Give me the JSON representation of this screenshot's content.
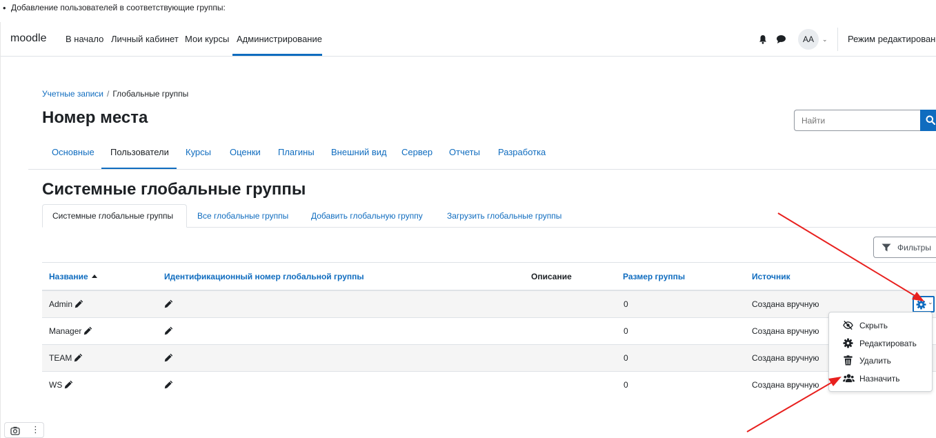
{
  "doc": {
    "bullet": "•",
    "caption": "Добавление пользователей в соответствующие группы:"
  },
  "navbar": {
    "brand": "moodle",
    "links": [
      "В начало",
      "Личный кабинет",
      "Мои курсы",
      "Администрирование"
    ],
    "active_link": "Администрирование",
    "avatar_initials": "AA",
    "edit_mode_label": "Режим редактирования"
  },
  "breadcrumb": {
    "parent": "Учетные записи",
    "separator": "/",
    "current": "Глобальные группы"
  },
  "page": {
    "title": "Номер места",
    "search_placeholder": "Найти"
  },
  "secondary_nav": {
    "tabs": [
      "Основные",
      "Пользователи",
      "Курсы",
      "Оценки",
      "Плагины",
      "Внешний вид",
      "Сервер",
      "Отчеты",
      "Разработка"
    ],
    "active": "Пользователи"
  },
  "section": {
    "title": "Системные глобальные группы",
    "tabs": [
      "Системные глобальные группы",
      "Все глобальные группы",
      "Добавить глобальную группу",
      "Загрузить глобальные группы"
    ],
    "active_tab": "Системные глобальные группы",
    "filters_label": "Фильтры"
  },
  "table": {
    "headers": [
      "Название",
      "Идентификационный номер глобальной группы",
      "Описание",
      "Размер группы",
      "Источник"
    ],
    "rows": [
      {
        "name": "Admin",
        "idnumber": "",
        "description": "",
        "size": "0",
        "source": "Создана вручную"
      },
      {
        "name": "Manager",
        "idnumber": "",
        "description": "",
        "size": "0",
        "source": "Создана вручную"
      },
      {
        "name": "TEAM",
        "idnumber": "",
        "description": "",
        "size": "0",
        "source": "Создана вручную"
      },
      {
        "name": "WS",
        "idnumber": "",
        "description": "",
        "size": "0",
        "source": "Создана вручную"
      }
    ]
  },
  "action_menu": {
    "items": [
      {
        "label": "Скрыть",
        "icon": "eye-slash-icon"
      },
      {
        "label": "Редактировать",
        "icon": "gear-icon"
      },
      {
        "label": "Удалить",
        "icon": "trash-icon"
      },
      {
        "label": "Назначить",
        "icon": "users-icon"
      }
    ]
  },
  "colors": {
    "primary": "#0f6cbf",
    "annotation_arrow": "#e8201e"
  }
}
